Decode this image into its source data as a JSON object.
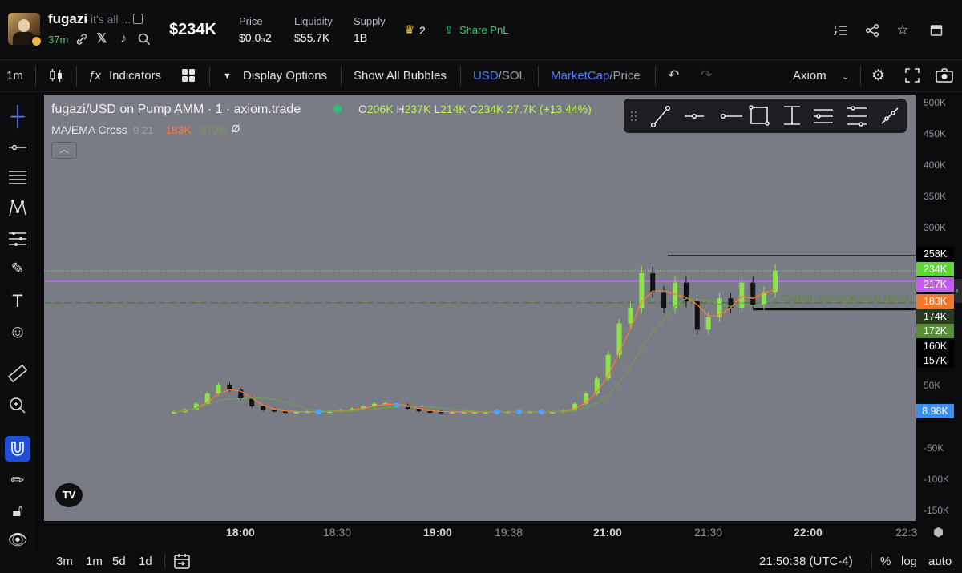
{
  "header": {
    "token_name": "fugazi",
    "token_desc": "it's all ...",
    "age": "37m",
    "market_cap": "$234K",
    "stats": [
      {
        "label": "Price",
        "value": "$0.0₃2"
      },
      {
        "label": "Liquidity",
        "value": "$55.7K"
      },
      {
        "label": "Supply",
        "value": "1B"
      }
    ],
    "holders_count": "2",
    "share_label": "Share PnL",
    "icons": [
      "link-icon",
      "x-icon",
      "tiktok-icon",
      "search-icon",
      "list-icon",
      "share-icon",
      "star-icon",
      "window-icon"
    ]
  },
  "toolbar": {
    "interval": "1m",
    "indicators": "Indicators",
    "display_options": "Display Options",
    "show_bubbles": "Show All Bubbles",
    "currency_active": "USD",
    "currency_other": "/SOL",
    "metric_active": "MarketCap",
    "metric_other": "/Price",
    "layout_name": "Axiom"
  },
  "chart": {
    "legend_title": "fugazi/USD on Pump AMM · 1 · axiom.trade",
    "ohlc": {
      "o_label": "O",
      "o": "206K",
      "h_label": "H",
      "h": "237K",
      "l_label": "L",
      "l": "214K",
      "c_label": "C",
      "c": "234K",
      "change": "27.7K (+13.44%)"
    },
    "indicator": {
      "name": "MA/EMA Cross",
      "params": "9 21",
      "v1": "183K",
      "v2": "172K",
      "eye": "Ø"
    },
    "cost_basis_label": "Current Average Cost Basis",
    "tv_logo": "TV",
    "colors": {
      "background": "#797c84",
      "up": "#8ce44a",
      "down": "#111111",
      "ma_fast": "#ff7a2a",
      "ma_slow": "#6fa24a",
      "purple_line": "#c25cf0"
    }
  },
  "price_axis": {
    "ticks": [
      "500K",
      "450K",
      "400K",
      "350K",
      "300K",
      "50K",
      "-50K",
      "-100K",
      "-150K"
    ],
    "labels": [
      {
        "text": "258K",
        "bg": "#000000"
      },
      {
        "text": "234K",
        "bg": "#5fd43a"
      },
      {
        "text": "217K",
        "bg": "#c25cf0"
      },
      {
        "text": "183K",
        "bg": "#f0762a"
      },
      {
        "text": "174K",
        "bg": "#2a3a1f"
      },
      {
        "text": "172K",
        "bg": "#5a8f3a"
      },
      {
        "text": "160K",
        "bg": "#000000"
      },
      {
        "text": "157K",
        "bg": "#000000"
      },
      {
        "text": "8.98K",
        "bg": "#3a8ef0"
      }
    ]
  },
  "time_axis": {
    "ticks": [
      {
        "text": "18:00",
        "bold": true
      },
      {
        "text": "18:30",
        "bold": false
      },
      {
        "text": "19:00",
        "bold": true
      },
      {
        "text": "19:38",
        "bold": false
      },
      {
        "text": "21:00",
        "bold": true
      },
      {
        "text": "21:30",
        "bold": false
      },
      {
        "text": "22:00",
        "bold": true
      },
      {
        "text": "22:3",
        "bold": false
      }
    ]
  },
  "bottombar": {
    "ranges": [
      "3m",
      "1m",
      "5d",
      "1d"
    ],
    "clock": "21:50:38 (UTC-4)",
    "percent": "%",
    "log": "log",
    "auto": "auto"
  },
  "chart_data": {
    "type": "candlestick",
    "title": "fugazi/USD on Pump AMM · 1 · axiom.trade",
    "y_ticks": [
      -150000,
      -100000,
      -50000,
      50000,
      300000,
      350000,
      400000,
      450000,
      500000
    ],
    "x_ticks": [
      "18:00",
      "18:30",
      "19:00",
      "19:38",
      "21:00",
      "21:30",
      "22:00",
      "22:3"
    ],
    "ylim": [
      -165000,
      515000
    ],
    "series": [
      {
        "name": "MarketCap (approx.)",
        "values": [
          9000,
          13000,
          22000,
          38000,
          52000,
          44000,
          30000,
          18000,
          12000,
          10000,
          9000,
          9000,
          10000,
          9000,
          10000,
          12000,
          14000,
          18000,
          22000,
          23000,
          20000,
          14000,
          10000,
          9500,
          9000,
          9000,
          9000,
          9000,
          9000,
          9000,
          9500,
          9000,
          9500,
          9000,
          9000,
          11000,
          22000,
          38000,
          62000,
          100000,
          150000,
          175000,
          230000,
          200000,
          175000,
          215000,
          185000,
          140000,
          160000,
          190000,
          175000,
          215000,
          180000,
          200000,
          234000
        ]
      }
    ],
    "horizontal_lines": [
      {
        "value": 258000,
        "color": "#000000"
      },
      {
        "value": 234000,
        "color": "#9bea3c"
      },
      {
        "value": 217000,
        "color": "#c25cf0"
      },
      {
        "value": 183000,
        "color": "#4f7a2e",
        "label": "Current Average Cost Basis"
      },
      {
        "value": 174000,
        "color": "#000000"
      },
      {
        "value": 172000,
        "color": "#000000"
      }
    ],
    "ohlc": {
      "open": 206000,
      "high": 237000,
      "low": 214000,
      "close": 234000,
      "change": 27700,
      "change_pct": 13.44
    },
    "grid": false
  }
}
